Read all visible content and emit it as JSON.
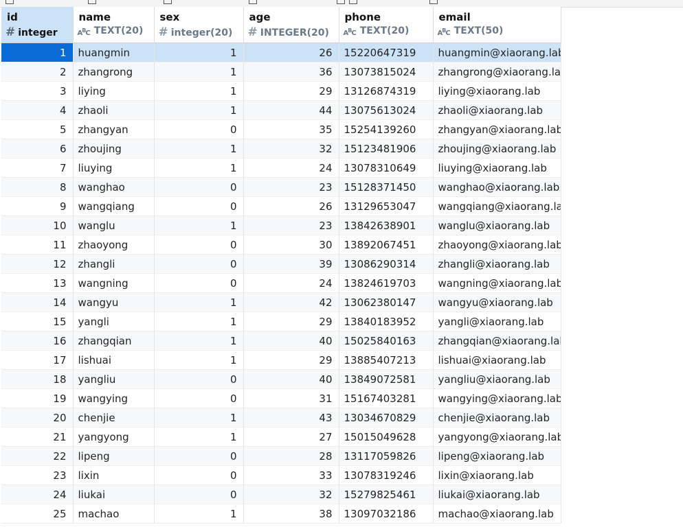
{
  "columns": [
    {
      "name": "id",
      "type": "integer",
      "icon": "hash-icon"
    },
    {
      "name": "name",
      "type": "TEXT(20)",
      "icon": "text-type-icon"
    },
    {
      "name": "sex",
      "type": "integer(20)",
      "icon": "hash-icon"
    },
    {
      "name": "age",
      "type": "INTEGER(20)",
      "icon": "hash-icon"
    },
    {
      "name": "phone",
      "type": "TEXT(20)",
      "icon": "text-type-icon"
    },
    {
      "name": "email",
      "type": "TEXT(50)",
      "icon": "text-type-icon"
    }
  ],
  "selected_row": 0,
  "rows": [
    {
      "id": "1",
      "name": "huangmin",
      "sex": "1",
      "age": "26",
      "phone": "15220647319",
      "email": "huangmin@xiaorang.lab"
    },
    {
      "id": "2",
      "name": "zhangrong",
      "sex": "1",
      "age": "36",
      "phone": "13073815024",
      "email": "zhangrong@xiaorang.la"
    },
    {
      "id": "3",
      "name": "liying",
      "sex": "1",
      "age": "29",
      "phone": "13126874319",
      "email": "liying@xiaorang.lab"
    },
    {
      "id": "4",
      "name": "zhaoli",
      "sex": "1",
      "age": "44",
      "phone": "13075613024",
      "email": "zhaoli@xiaorang.lab"
    },
    {
      "id": "5",
      "name": "zhangyan",
      "sex": "0",
      "age": "35",
      "phone": "15254139260",
      "email": "zhangyan@xiaorang.lab"
    },
    {
      "id": "6",
      "name": "zhoujing",
      "sex": "1",
      "age": "32",
      "phone": "15123481906",
      "email": "zhoujing@xiaorang.lab"
    },
    {
      "id": "7",
      "name": "liuying",
      "sex": "1",
      "age": "24",
      "phone": "13078310649",
      "email": "liuying@xiaorang.lab"
    },
    {
      "id": "8",
      "name": "wanghao",
      "sex": "0",
      "age": "23",
      "phone": "15128371450",
      "email": "wanghao@xiaorang.lab"
    },
    {
      "id": "9",
      "name": "wangqiang",
      "sex": "0",
      "age": "26",
      "phone": "13129653047",
      "email": "wangqiang@xiaorang.la"
    },
    {
      "id": "10",
      "name": "wanglu",
      "sex": "1",
      "age": "23",
      "phone": "13842638901",
      "email": "wanglu@xiaorang.lab"
    },
    {
      "id": "11",
      "name": "zhaoyong",
      "sex": "0",
      "age": "30",
      "phone": "13892067451",
      "email": "zhaoyong@xiaorang.lab"
    },
    {
      "id": "12",
      "name": "zhangli",
      "sex": "0",
      "age": "39",
      "phone": "13086290314",
      "email": "zhangli@xiaorang.lab"
    },
    {
      "id": "13",
      "name": "wangning",
      "sex": "0",
      "age": "24",
      "phone": "13824619703",
      "email": "wangning@xiaorang.lab"
    },
    {
      "id": "14",
      "name": "wangyu",
      "sex": "1",
      "age": "42",
      "phone": "13062380147",
      "email": "wangyu@xiaorang.lab"
    },
    {
      "id": "15",
      "name": "yangli",
      "sex": "1",
      "age": "29",
      "phone": "13840183952",
      "email": "yangli@xiaorang.lab"
    },
    {
      "id": "16",
      "name": "zhangqian",
      "sex": "1",
      "age": "40",
      "phone": "15025840163",
      "email": "zhangqian@xiaorang.lab"
    },
    {
      "id": "17",
      "name": "lishuai",
      "sex": "1",
      "age": "29",
      "phone": "13885407213",
      "email": "lishuai@xiaorang.lab"
    },
    {
      "id": "18",
      "name": "yangliu",
      "sex": "0",
      "age": "40",
      "phone": "13849072581",
      "email": "yangliu@xiaorang.lab"
    },
    {
      "id": "19",
      "name": "wangying",
      "sex": "0",
      "age": "31",
      "phone": "15167403281",
      "email": "wangying@xiaorang.lab"
    },
    {
      "id": "20",
      "name": "chenjie",
      "sex": "1",
      "age": "43",
      "phone": "13034670829",
      "email": "chenjie@xiaorang.lab"
    },
    {
      "id": "21",
      "name": "yangyong",
      "sex": "1",
      "age": "27",
      "phone": "15015049628",
      "email": "yangyong@xiaorang.lab"
    },
    {
      "id": "22",
      "name": "lipeng",
      "sex": "0",
      "age": "28",
      "phone": "13117059826",
      "email": "lipeng@xiaorang.lab"
    },
    {
      "id": "23",
      "name": "lixin",
      "sex": "0",
      "age": "33",
      "phone": "13078319246",
      "email": "lixin@xiaorang.lab"
    },
    {
      "id": "24",
      "name": "liukai",
      "sex": "0",
      "age": "32",
      "phone": "15279825461",
      "email": "liukai@xiaorang.lab"
    },
    {
      "id": "25",
      "name": "machao",
      "sex": "1",
      "age": "38",
      "phone": "13097032186",
      "email": "machao@xiaorang.lab"
    }
  ]
}
